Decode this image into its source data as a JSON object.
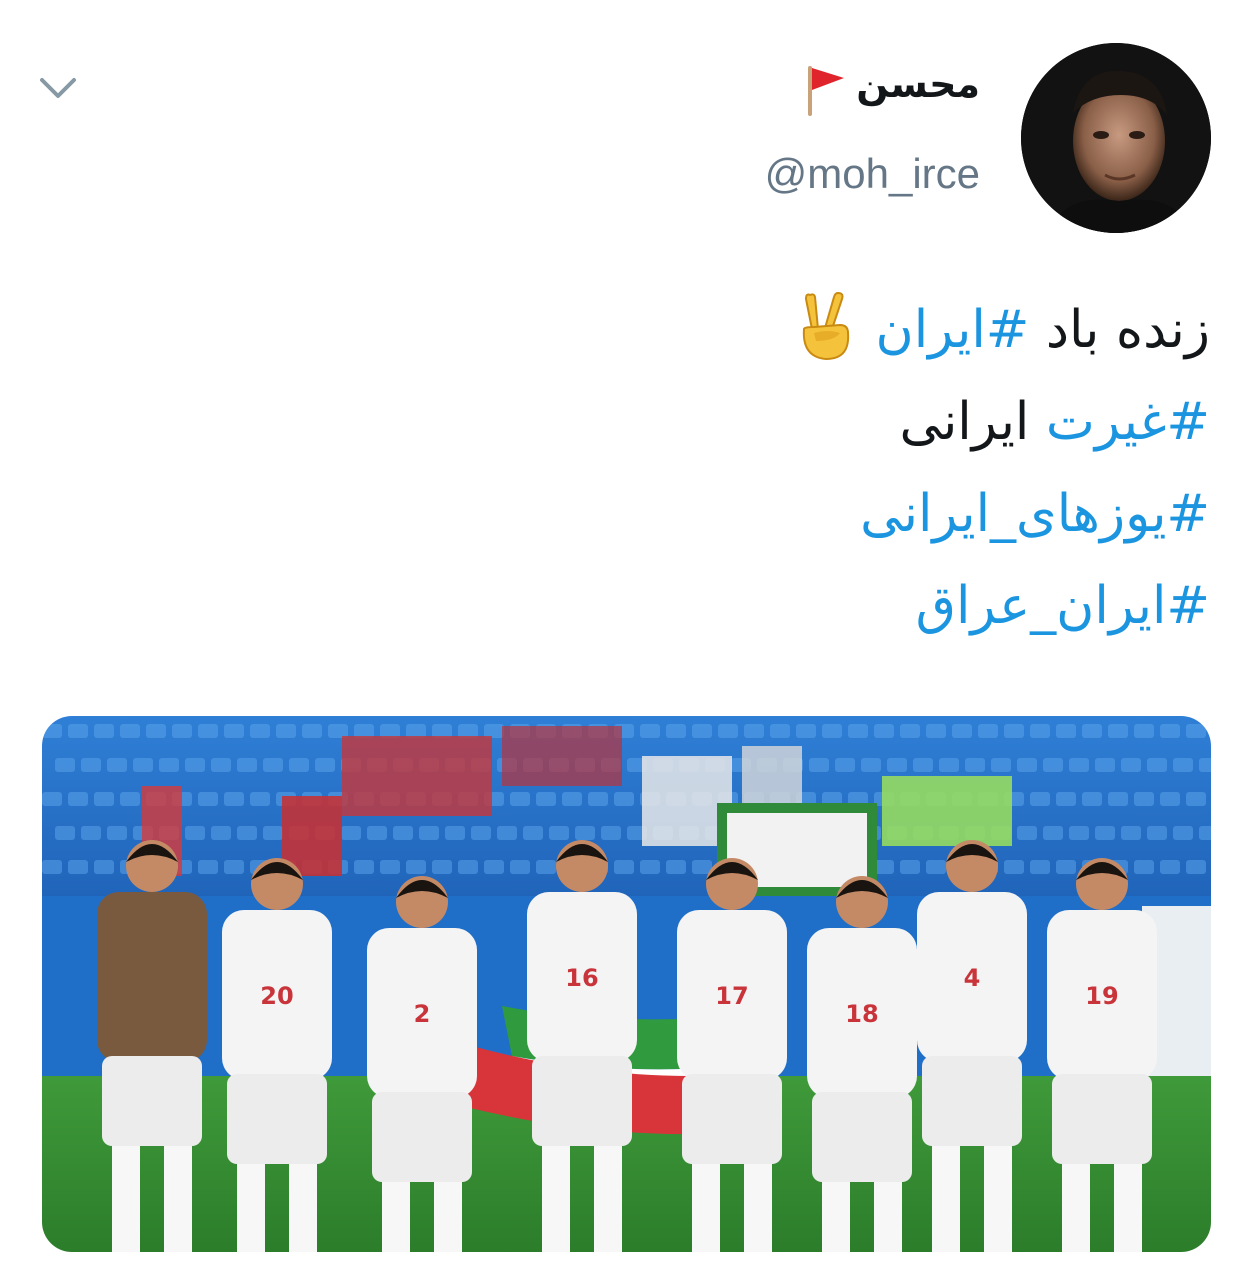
{
  "tweet": {
    "author": {
      "display_name": "محسن",
      "handle": "@moh_irce",
      "flag_icon": "red-triangular-flag-icon"
    },
    "menu_icon": "chevron-down-icon",
    "text": {
      "line1": {
        "prefix": "زنده باد ",
        "hashtag": "#ایران",
        "emoji": "victory-hand-icon"
      },
      "line2": {
        "hashtag": "#غیرت",
        "suffix": " ایرانی"
      },
      "line3": {
        "hashtag": "#یوزهای_ایرانی"
      },
      "line4": {
        "hashtag": "#ایران_عراق"
      }
    },
    "media": {
      "type": "photo",
      "jersey_numbers": [
        "20",
        "2",
        "16",
        "17",
        "18",
        "4",
        "19"
      ]
    },
    "colors": {
      "hashtag": "#1b95e0",
      "text": "#14171a",
      "handle": "#657786",
      "chevron": "#8899a6"
    }
  }
}
